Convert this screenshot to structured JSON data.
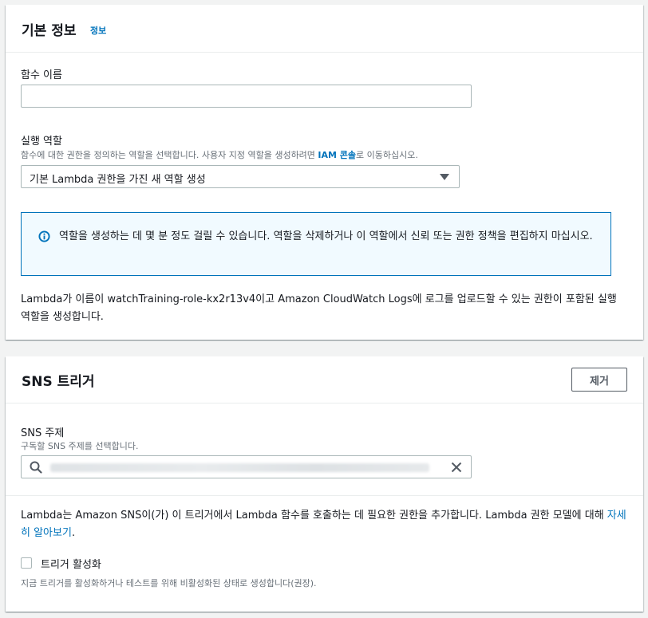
{
  "basic_info": {
    "title": "기본 정보",
    "info_link": "정보",
    "function_name": {
      "label": "함수 이름",
      "value": ""
    },
    "execution_role": {
      "label": "실행 역할",
      "description_prefix": "함수에 대한 권한을 정의하는 역할을 선택합니다. 사용자 지정 역할을 생성하려면 ",
      "description_link": "IAM 콘솔",
      "description_suffix": "로 이동하십시오.",
      "selected": "기본 Lambda 권한을 가진 새 역할 생성"
    },
    "alert": {
      "text": "역할을 생성하는 데 몇 분 정도 걸릴 수 있습니다. 역할을 삭제하거나 이 역할에서 신뢰 또는 권한 정책을 편집하지 마십시오."
    },
    "role_note": "Lambda가 이름이 watchTraining-role-kx2r13v4이고 Amazon CloudWatch Logs에 로그를 업로드할 수 있는 권한이 포함된 실행 역할을 생성합니다."
  },
  "sns_trigger": {
    "title": "SNS 트리거",
    "remove_label": "제거",
    "topic": {
      "label": "SNS 주제",
      "description": "구독할 SNS 주제를 선택합니다."
    },
    "permission_note_prefix": "Lambda는 Amazon SNS이(가) 이 트리거에서 Lambda 함수를 호출하는 데 필요한 권한을 추가합니다. Lambda 권한 모델에 대해 ",
    "permission_note_link": "자세히 알아보기",
    "permission_note_suffix": ".",
    "enable_trigger": {
      "label": "트리거 활성화",
      "checked": false,
      "description": "지금 트리거를 활성화하거나 테스트를 위해 비활성화된 상태로 생성합니다(권장)."
    }
  },
  "colors": {
    "link": "#0073bb",
    "alert_border": "#0073bb",
    "alert_bg": "#f1faff",
    "text": "#16191f",
    "muted": "#687078"
  }
}
